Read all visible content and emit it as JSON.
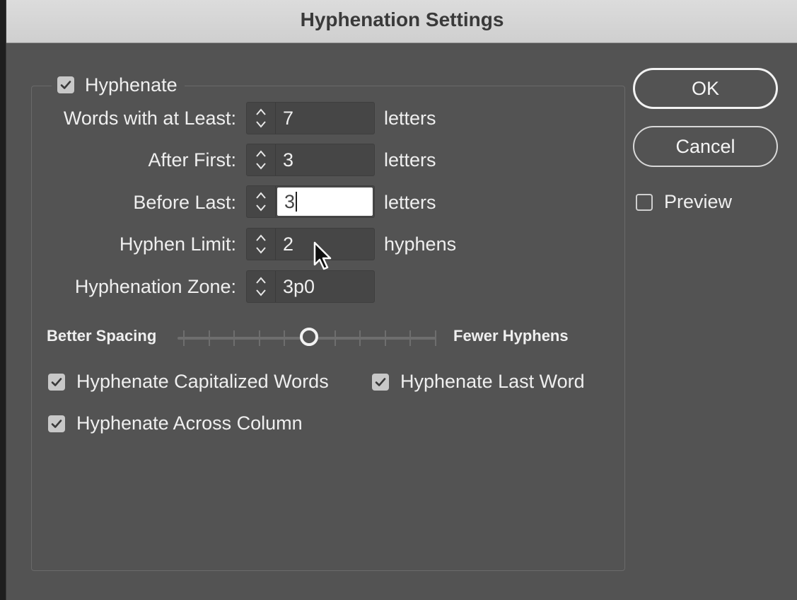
{
  "window": {
    "title": "Hyphenation Settings"
  },
  "hyphenate": {
    "label": "Hyphenate",
    "checked": true
  },
  "fields": [
    {
      "label": "Words with at Least:",
      "value": "7",
      "unit": "letters"
    },
    {
      "label": "After First:",
      "value": "3",
      "unit": "letters"
    },
    {
      "label": "Before Last:",
      "value": "3",
      "unit": "letters"
    },
    {
      "label": "Hyphen Limit:",
      "value": "2",
      "unit": "hyphens"
    },
    {
      "label": "Hyphenation Zone:",
      "value": "3p0",
      "unit": ""
    }
  ],
  "slider": {
    "left_label": "Better Spacing",
    "right_label": "Fewer Hyphens",
    "position_fraction": 0.5
  },
  "options": {
    "capitalized": {
      "label": "Hyphenate Capitalized Words",
      "checked": true
    },
    "last_word": {
      "label": "Hyphenate Last Word",
      "checked": true
    },
    "across_column": {
      "label": "Hyphenate Across Column",
      "checked": true
    }
  },
  "buttons": {
    "ok": "OK",
    "cancel": "Cancel"
  },
  "preview": {
    "label": "Preview",
    "checked": false
  },
  "icons": {
    "checkbox_checked": "checkmark-icon",
    "spinner": "stepper-arrows-icon",
    "cursor": "mouse-pointer-icon"
  },
  "colors": {
    "dialog_bg": "#535353",
    "titlebar_bg": "#d6d6d6",
    "text": "#efefef",
    "field_bg": "#464646"
  }
}
